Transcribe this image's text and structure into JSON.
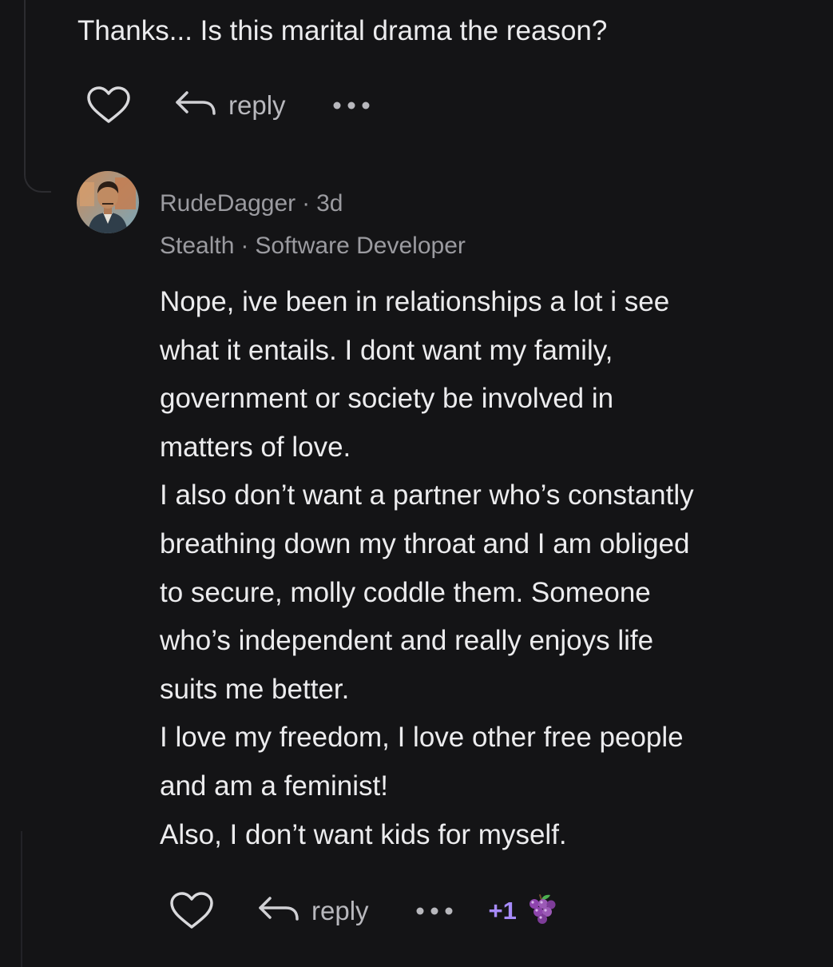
{
  "previous_comment": {
    "text": "Thanks... Is this marital drama the reason?",
    "actions": {
      "like_icon": "heart-icon",
      "reply_icon": "reply-arrow-icon",
      "reply_label": "reply",
      "more_icon": "more-dots-icon"
    }
  },
  "comment": {
    "author": {
      "name": "RudeDagger",
      "time": "3d",
      "company": "Stealth",
      "title": "Software Developer",
      "avatar_icon": "avatar-portrait"
    },
    "lines": [
      "Nope, ive been in relationships a lot i see",
      "what it entails. I dont want my family,",
      "government or society be involved in",
      "matters of love.",
      "I also don’t want a partner who’s constantly",
      "breathing down my throat and I am obliged",
      "to secure, molly coddle them. Someone",
      "who’s independent and really enjoys life",
      "suits me better.",
      "I love my freedom, I love other free people",
      "and am a feminist!",
      "Also, I don’t want kids for myself."
    ],
    "actions": {
      "like_icon": "heart-icon",
      "reply_icon": "reply-arrow-icon",
      "reply_label": "reply",
      "more_icon": "more-dots-icon",
      "reaction_count": "+1",
      "reaction_icon": "grapes-icon"
    }
  },
  "colors": {
    "background": "#141416",
    "text_primary": "#ececee",
    "text_secondary": "#9b9ba0",
    "reaction_accent": "#a78bfa"
  }
}
